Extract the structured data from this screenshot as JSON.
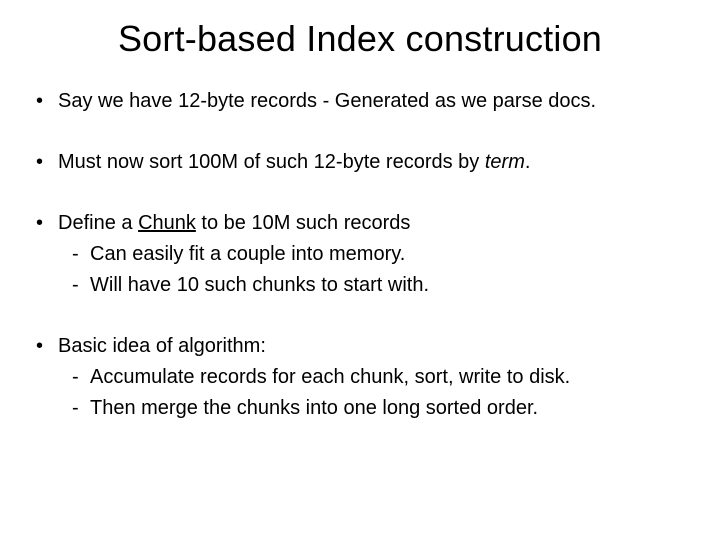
{
  "title": "Sort-based Index construction",
  "bullets": {
    "b1": "Say we have 12-byte records - Generated as we parse docs.",
    "b2_pre": "Must now sort 100M of such 12-byte records by ",
    "b2_term": "term",
    "b2_post": ".",
    "b3_pre": "Define a ",
    "b3_chunk": "Chunk",
    "b3_post": " to be 10M such records",
    "b3_sub1": "Can easily fit a couple into memory.",
    "b3_sub2": "Will have 10 such chunks to start with.",
    "b4": "Basic idea of algorithm:",
    "b4_sub1": "Accumulate records for each chunk, sort, write to disk.",
    "b4_sub2": "Then merge the chunks into one long sorted order."
  }
}
